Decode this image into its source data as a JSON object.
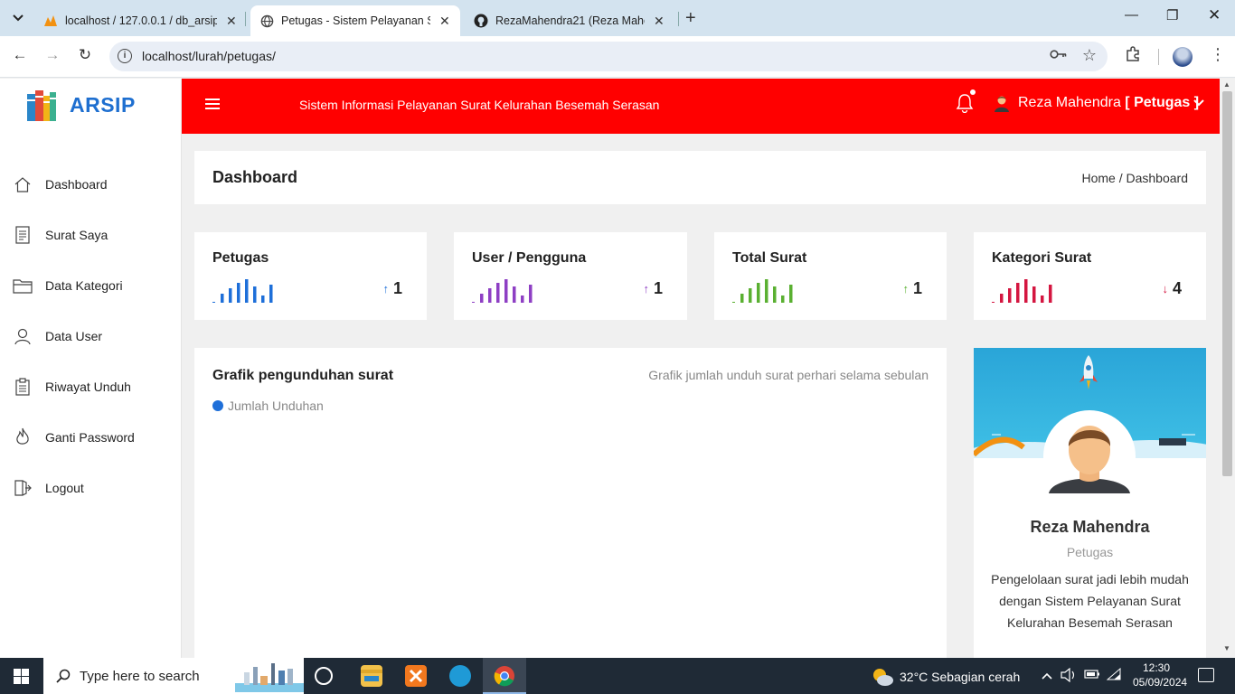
{
  "browser": {
    "tabs": [
      {
        "title": "localhost / 127.0.0.1 / db_arsip |"
      },
      {
        "title": "Petugas - Sistem Pelayanan Sur"
      },
      {
        "title": "RezaMahendra21 (Reza Mahendra)"
      }
    ],
    "url": "localhost/lurah/petugas/"
  },
  "sidebar": {
    "brand": "ARSIP",
    "items": [
      {
        "label": "Dashboard",
        "icon": "home-icon"
      },
      {
        "label": "Surat Saya",
        "icon": "document-icon"
      },
      {
        "label": "Data Kategori",
        "icon": "folder-icon"
      },
      {
        "label": "Data User",
        "icon": "user-icon"
      },
      {
        "label": "Riwayat Unduh",
        "icon": "history-icon"
      },
      {
        "label": "Ganti Password",
        "icon": "flame-icon"
      },
      {
        "label": "Logout",
        "icon": "logout-icon"
      }
    ]
  },
  "topbar": {
    "title": "Sistem Informasi Pelayanan Surat Kelurahan Besemah Serasan",
    "user_name": "Reza Mahendra",
    "user_role": "Petugas"
  },
  "header": {
    "title": "Dashboard",
    "breadcrumb": "Home / Dashboard"
  },
  "stats": [
    {
      "title": "Petugas",
      "value": "1",
      "trend": "up",
      "color": "#1e6fd9"
    },
    {
      "title": "User / Pengguna",
      "value": "1",
      "trend": "up",
      "color": "#8e3fc4"
    },
    {
      "title": "Total Surat",
      "value": "1",
      "trend": "up",
      "color": "#5ab031"
    },
    {
      "title": "Kategori Surat",
      "value": "4",
      "trend": "down",
      "color": "#d41640"
    }
  ],
  "chart": {
    "title": "Grafik pengunduhan surat",
    "subtitle": "Grafik jumlah unduh surat perhari selama sebulan",
    "legend": "Jumlah Unduhan",
    "legend_color": "#1e6fd9"
  },
  "profile": {
    "name": "Reza Mahendra",
    "role": "Petugas",
    "description": "Pengelolaan surat jadi lebih mudah dengan Sistem Pelayanan Surat Kelurahan Besemah Serasan"
  },
  "taskbar": {
    "search_placeholder": "Type here to search",
    "weather": "32°C  Sebagian cerah",
    "time": "12:30",
    "date": "05/09/2024"
  }
}
